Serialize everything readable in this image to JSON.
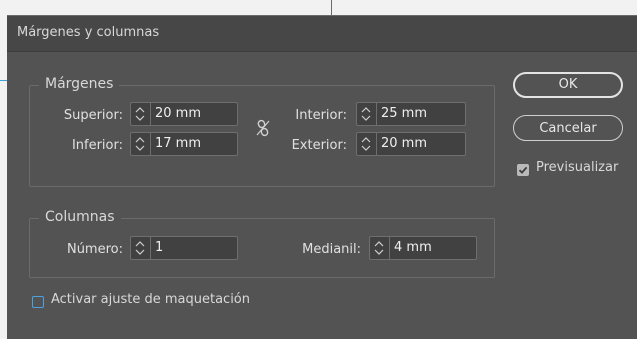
{
  "dialog": {
    "title": "Márgenes y columnas"
  },
  "margins": {
    "legend": "Márgenes",
    "top": {
      "label": "Superior:",
      "value": "20 mm"
    },
    "bottom": {
      "label": "Inferior:",
      "value": "17 mm"
    },
    "inside": {
      "label": "Interior:",
      "value": "25 mm"
    },
    "outside": {
      "label": "Exterior:",
      "value": "20 mm"
    },
    "link_icon": "unlink-chain-icon"
  },
  "columns": {
    "legend": "Columnas",
    "number": {
      "label": "Número:",
      "value": "1"
    },
    "gutter": {
      "label": "Medianil:",
      "value": "4 mm"
    }
  },
  "buttons": {
    "ok": "OK",
    "cancel": "Cancelar"
  },
  "preview": {
    "label": "Previsualizar",
    "checked": true
  },
  "layout_adjust": {
    "label": "Activar ajuste de maquetación",
    "checked": false
  },
  "colors": {
    "dialog_bg": "#535353",
    "titlebar_bg": "#474747",
    "field_bg": "#414141",
    "checkbox_accent": "#4aa3e0"
  }
}
